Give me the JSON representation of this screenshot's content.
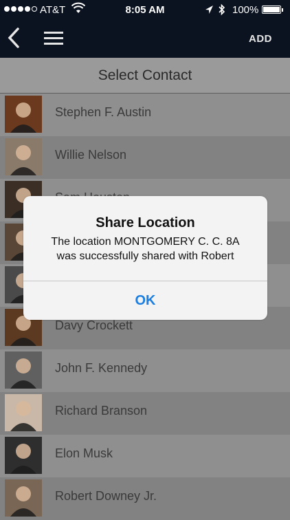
{
  "status_bar": {
    "carrier": "AT&T",
    "time": "8:05 AM",
    "battery": "100%",
    "signal_bars": 5,
    "battery_level": 1.0
  },
  "nav": {
    "back_icon": "chevron-left-icon",
    "menu_icon": "hamburger-icon",
    "add_label": "ADD"
  },
  "header": {
    "title": "Select Contact"
  },
  "contacts": [
    {
      "name": "Stephen F. Austin",
      "avatar_color": "#6b3a1e"
    },
    {
      "name": "Willie Nelson",
      "avatar_color": "#8a7a6a"
    },
    {
      "name": "Sam Houston",
      "avatar_color": "#3a2e25"
    },
    {
      "name": "",
      "avatar_color": "#5a4636"
    },
    {
      "name": "",
      "avatar_color": "#4a4a4a"
    },
    {
      "name": "Davy Crockett",
      "avatar_color": "#5c3a22"
    },
    {
      "name": "John F. Kennedy",
      "avatar_color": "#606060"
    },
    {
      "name": "Richard Branson",
      "avatar_color": "#c9b8a8"
    },
    {
      "name": "Elon Musk",
      "avatar_color": "#2e2e2e"
    },
    {
      "name": "Robert Downey Jr.",
      "avatar_color": "#7a6655"
    }
  ],
  "alert": {
    "title": "Share Location",
    "message": "The location MONTGOMERY  C. C.  8A\nwas successfully shared with Robert",
    "button": "OK"
  },
  "colors": {
    "navbar": "#0b1220",
    "alert_button": "#1b7ee0"
  }
}
